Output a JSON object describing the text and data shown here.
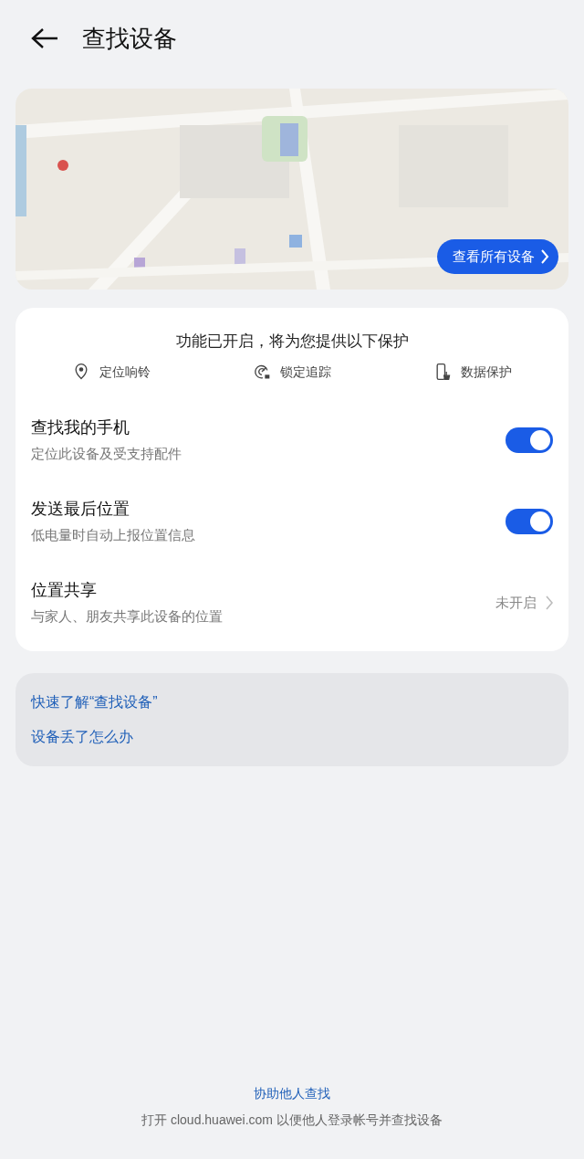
{
  "header": {
    "title": "查找设备"
  },
  "map": {
    "kind": "picture",
    "button": "查看所有设备"
  },
  "protection": {
    "title": "功能已开启，将为您提供以下保护",
    "features": [
      {
        "kind": "pin",
        "label": "定位响铃"
      },
      {
        "kind": "radar",
        "label": "锁定追踪"
      },
      {
        "kind": "phone",
        "label": "数据保护"
      }
    ]
  },
  "settings": [
    {
      "kind": "toggle",
      "title": "查找我的手机",
      "subtitle": "定位此设备及受支持配件",
      "on": true
    },
    {
      "kind": "toggle",
      "title": "发送最后位置",
      "subtitle": "低电量时自动上报位置信息",
      "on": true
    },
    {
      "kind": "link",
      "title": "位置共享",
      "subtitle": "与家人、朋友共享此设备的位置",
      "status": "未开启"
    }
  ],
  "help_links": [
    "快速了解“查找设备”",
    "设备丢了怎么办"
  ],
  "footer": {
    "link": "协助他人查找",
    "note": "打开 cloud.huawei.com 以便他人登录帐号并查找设备"
  }
}
